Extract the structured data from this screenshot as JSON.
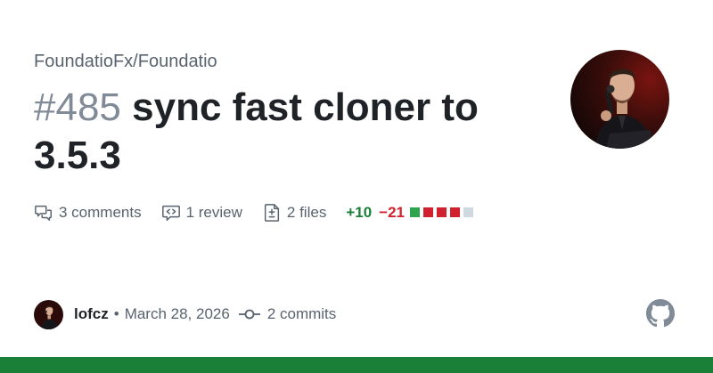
{
  "repository": "FoundatioFx/Foundatio",
  "pull_request": {
    "number": "#485",
    "title": "sync fast cloner to 3.5.3"
  },
  "stats": {
    "comments": "3 comments",
    "reviews": "1 review",
    "files": "2 files",
    "additions": "+10",
    "deletions": "−21",
    "diff_blocks": [
      "added",
      "removed",
      "removed",
      "removed",
      "neutral"
    ]
  },
  "footer": {
    "author": "lofcz",
    "separator": "•",
    "date": "March 28, 2026",
    "commits": "2 commits"
  },
  "colors": {
    "added": "#2da44e",
    "removed": "#cf222e",
    "neutral": "#d1d9e0",
    "brand_bar": "#1a7f37"
  },
  "icons": {
    "comments": "comment-discussion-icon",
    "review": "code-review-icon",
    "files": "file-diff-icon",
    "commits": "git-commit-icon",
    "logo": "github-mark-icon"
  }
}
